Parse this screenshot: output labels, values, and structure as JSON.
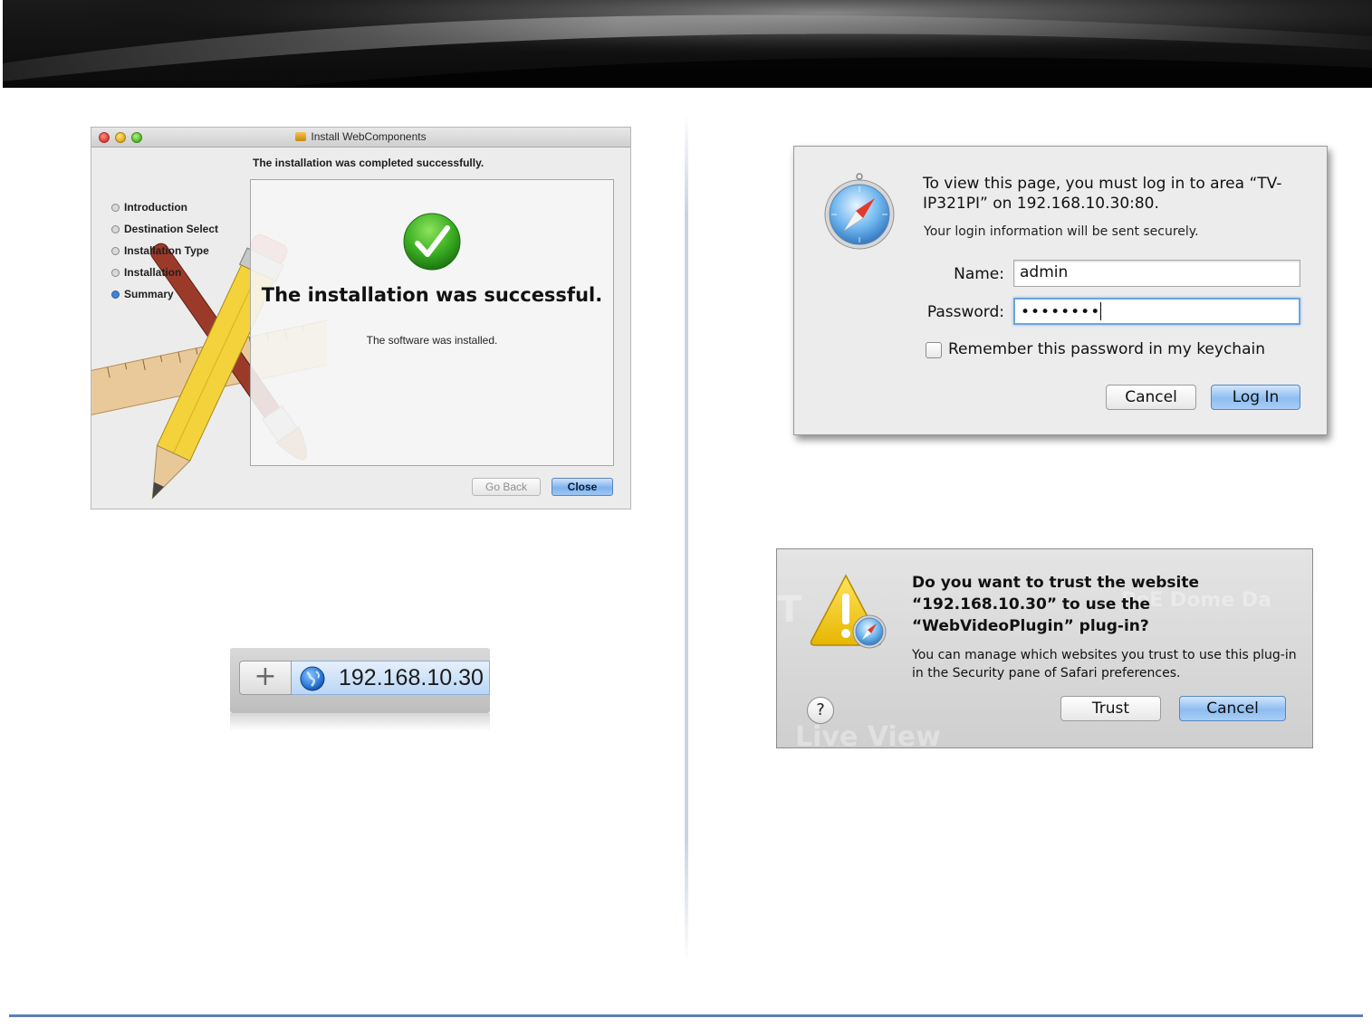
{
  "installer": {
    "window_title": "Install WebComponents",
    "heading": "The installation was completed successfully.",
    "steps": [
      {
        "label": "Introduction",
        "active": false
      },
      {
        "label": "Destination Select",
        "active": false
      },
      {
        "label": "Installation Type",
        "active": false
      },
      {
        "label": "Installation",
        "active": false
      },
      {
        "label": "Summary",
        "active": true
      }
    ],
    "success_title": "The installation was successful.",
    "success_sub": "The software was installed.",
    "go_back_label": "Go Back",
    "close_label": "Close",
    "icons": {
      "window_controls": [
        "close-icon",
        "minimize-icon",
        "zoom-icon"
      ],
      "package": "package-icon",
      "status": "checkmark-icon",
      "artwork": "pencil-ruler-brush-icon"
    }
  },
  "address_bar": {
    "plus_label": "+",
    "url": "192.168.10.30",
    "icon": "globe-icon"
  },
  "login_dialog": {
    "message": "To view this page, you must log in to area “TV-IP321PI” on 192.168.10.30:80.",
    "secure_note": "Your login information will be sent securely.",
    "name_label": "Name:",
    "name_value": "admin",
    "password_label": "Password:",
    "password_value": "••••••••",
    "remember_label": "Remember this password in my keychain",
    "remember_checked": false,
    "cancel_label": "Cancel",
    "login_label": "Log In",
    "icon": "safari-compass-icon"
  },
  "trust_dialog": {
    "title": "Do you want to trust the website “192.168.10.30” to use the “WebVideoPlugin” plug-in?",
    "body": "You can manage which websites you trust to use this plug-in in the Security pane of Safari preferences.",
    "help_label": "?",
    "trust_label": "Trust",
    "cancel_label": "Cancel",
    "background_text": "Live View",
    "background_text_2": "PoE Dome Da",
    "icon": "warning-icon"
  },
  "colors": {
    "banner": "#111111",
    "rule_blue": "#5b80b8",
    "default_button": "#8dbdf1"
  }
}
